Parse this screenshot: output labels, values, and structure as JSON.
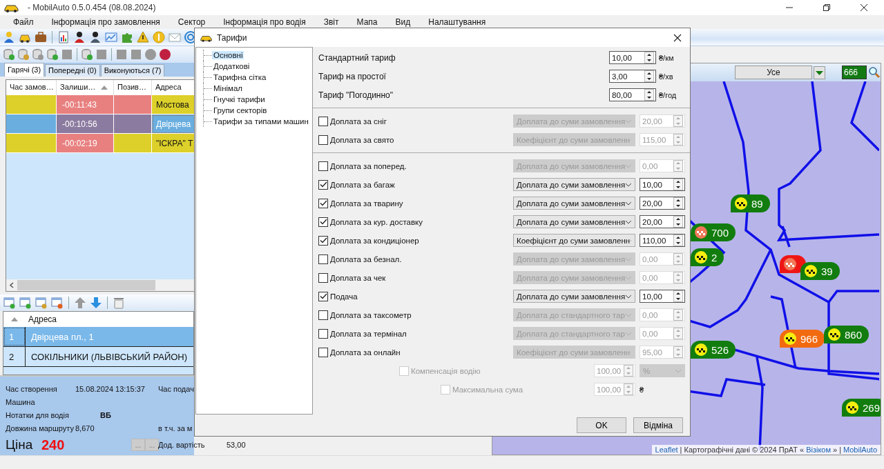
{
  "window": {
    "title": "- MobilAuto 0.5.0.454 (08.08.2024)"
  },
  "menu": [
    {
      "label": "Файл"
    },
    {
      "label": "Інформація про замовлення"
    },
    {
      "label": "Сектор"
    },
    {
      "label": "Інформація про водія"
    },
    {
      "label": "Звіт"
    },
    {
      "label": "Мапа"
    },
    {
      "label": "Вид"
    },
    {
      "label": "Налаштування"
    }
  ],
  "order_tabs": [
    {
      "label": "Гарячі (3)",
      "selected": true
    },
    {
      "label": "Попередні (0)",
      "selected": false
    },
    {
      "label": "Виконуються (7)",
      "selected": false
    }
  ],
  "orders_table": {
    "columns": [
      {
        "label": "Час замов…",
        "sorted": false
      },
      {
        "label": "Залиши…",
        "sorted": true
      },
      {
        "label": "Позив…",
        "sorted": false
      },
      {
        "label": "Адреса",
        "sorted": false
      }
    ],
    "rows": [
      {
        "selected": false,
        "cells": [
          {
            "color": "#ddd02a"
          },
          {
            "text": "-00:11:43",
            "color": "#e98080"
          },
          {
            "color": "#e98080"
          },
          {
            "text": "Мостова",
            "color": "#ddd02a"
          }
        ]
      },
      {
        "selected": true,
        "cells": [
          {
            "color": "#6aaee0"
          },
          {
            "text": "-00:10:56",
            "color": "#8c7ba0"
          },
          {
            "color": "#8c7ba0"
          },
          {
            "text": "Двірцева",
            "color": "#6aaee0"
          }
        ]
      },
      {
        "selected": false,
        "cells": [
          {
            "color": "#ddd02a"
          },
          {
            "text": "-00:02:19",
            "color": "#e98080"
          },
          {
            "color": "#ddd02a"
          },
          {
            "text": "\"ІСКРА\" Т",
            "color": "#ddd02a"
          }
        ]
      }
    ]
  },
  "address_table": {
    "column": "Адреса",
    "rows": [
      {
        "number": "1",
        "address": "Двірцева пл., 1",
        "selected": true
      },
      {
        "number": "2",
        "address": "СОКІЛЬНИКИ (ЛЬВІВСЬКИЙ РАЙОН)",
        "selected": false
      }
    ]
  },
  "order_info": {
    "created_label": "Час створення",
    "created_value": "15.08.2024 13:15:37",
    "pickup_label": "Час подач",
    "car_label": "Машина",
    "notes_label": "Нотатки для водія",
    "notes_value": "ВБ",
    "route_label": "Довжина маршруту",
    "route_value": "8,670",
    "included_label": "в т.ч. за м",
    "price_label": "Ціна",
    "price_value": "240",
    "price_button": "...",
    "extra_label": "Дод. вартість",
    "extra_value": "53,00",
    "extra_button": "..."
  },
  "map": {
    "filter": "Усе",
    "search_value": "666",
    "markers": [
      {
        "label": "89",
        "color": "#127d0e",
        "kind": "standard"
      },
      {
        "label": "700",
        "color": "#127d0e",
        "kind": "checkered"
      },
      {
        "label": "2",
        "color": "#127d0e",
        "kind": "standard"
      },
      {
        "color": "#ee1515",
        "kind": "checkered"
      },
      {
        "label": "39",
        "color": "#127d0e",
        "kind": "standard"
      },
      {
        "label": "966",
        "color": "#f26a10",
        "kind": "standard"
      },
      {
        "label": "860",
        "color": "#127d0e",
        "kind": "standard"
      },
      {
        "label": "526",
        "color": "#127d0e",
        "kind": "standard"
      },
      {
        "label": "269",
        "color": "#127d0e",
        "kind": "standard"
      }
    ],
    "attribution": [
      {
        "text": "Leaflet",
        "link": true
      },
      {
        "text": "| Картографічні дані © 2024 ПрАТ «",
        "link": false
      },
      {
        "text": "Візіком",
        "link": true
      },
      {
        "text": "» |",
        "link": false
      },
      {
        "text": "MobilAuto",
        "link": true
      }
    ]
  },
  "dialog": {
    "title": "Тарифи",
    "tree": [
      {
        "label": "Основні",
        "selected": true
      },
      {
        "label": "Додаткові",
        "selected": false
      },
      {
        "label": "Тарифна сітка",
        "selected": false
      },
      {
        "label": "Мінімал",
        "selected": false
      },
      {
        "label": "Гнучкі тарифи",
        "selected": false
      },
      {
        "label": "Групи секторів",
        "selected": false
      },
      {
        "label": "Тарифи за типами машин",
        "selected": false
      }
    ],
    "tariffs": [
      {
        "label": "Стандартний тариф",
        "value": "10,00",
        "unit": "₴/км"
      },
      {
        "label": "Тариф на простої",
        "value": "3,00",
        "unit": "₴/хв"
      },
      {
        "label": "Тариф \"Погодинно\"",
        "value": "80,00",
        "unit": "₴/год"
      }
    ],
    "surcharge_groups": [
      [
        {
          "label": "Доплата за сніг",
          "checked": false,
          "mode": "Доплата до суми замовлення",
          "value": "20,00"
        },
        {
          "label": "Доплата за свято",
          "checked": false,
          "mode": "Коефіцієнт до суми замовленн",
          "value": "115,00"
        }
      ],
      [
        {
          "label": "Доплата за поперед.",
          "checked": false,
          "mode": "Доплата до суми замовлення",
          "value": "0,00"
        },
        {
          "label": "Доплата за багаж",
          "checked": true,
          "mode": "Доплата до суми замовлення",
          "value": "10,00"
        },
        {
          "label": "Доплата за тварину",
          "checked": true,
          "mode": "Доплата до суми замовлення",
          "value": "20,00"
        },
        {
          "label": "Доплата за кур. доставку",
          "checked": true,
          "mode": "Доплата до суми замовлення",
          "value": "20,00"
        },
        {
          "label": "Доплата за кондиціонер",
          "checked": true,
          "mode": "Коефіцієнт до суми замовленн",
          "value": "110,00"
        },
        {
          "label": "Доплата за безнал.",
          "checked": false,
          "mode": "Доплата до суми замовлення",
          "value": "0,00"
        },
        {
          "label": "Доплата за чек",
          "checked": false,
          "mode": "Доплата до суми замовлення",
          "value": "0,00"
        },
        {
          "label": "Подача",
          "checked": true,
          "mode": "Доплата до суми замовлення",
          "value": "10,00"
        },
        {
          "label": "Доплата за таксометр",
          "checked": false,
          "mode": "Доплата до стандартного тар",
          "value": "0,00"
        },
        {
          "label": "Доплата за термінал",
          "checked": false,
          "mode": "Доплата до стандартного тар",
          "value": "0,00"
        },
        {
          "label": "Доплата за онлайн",
          "checked": false,
          "mode": "Коефіцієнт до суми замовленн",
          "value": "95,00"
        }
      ]
    ],
    "limits": [
      {
        "label": "Компенсація водію",
        "checked": false,
        "disabled": true,
        "value": "100,00",
        "unit": "%",
        "kind": "dropdown"
      },
      {
        "label": "Максимальна сума",
        "checked": false,
        "disabled": true,
        "value": "100,00",
        "unit": "₴",
        "kind": "text"
      }
    ],
    "buttons": [
      {
        "label": "OK"
      },
      {
        "label": "Відміна"
      }
    ]
  }
}
